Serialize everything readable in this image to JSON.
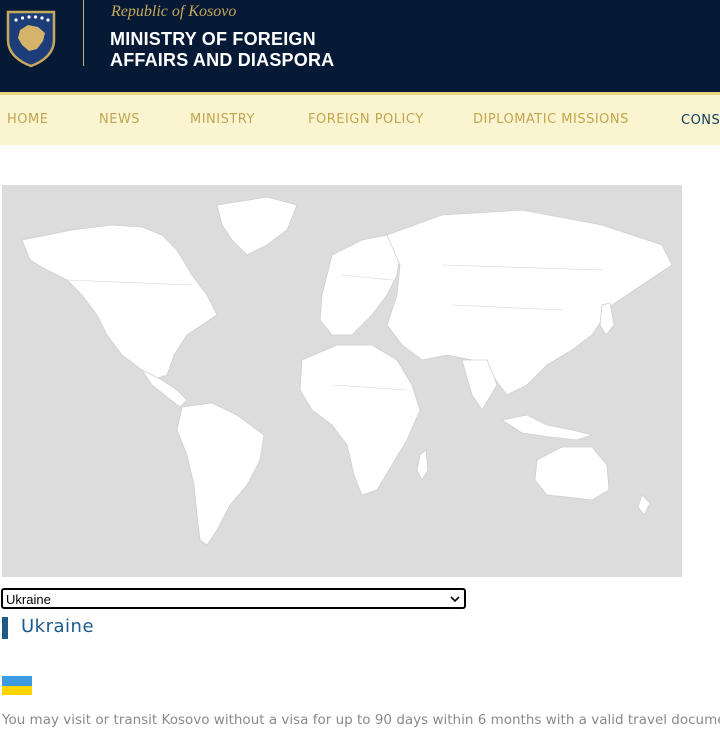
{
  "header": {
    "republic": "Republic of Kosovo",
    "ministry_line1": "MINISTRY OF FOREIGN",
    "ministry_line2": "AFFAIRS AND DIASPORA"
  },
  "nav": {
    "items": [
      {
        "label": "HOME"
      },
      {
        "label": "NEWS"
      },
      {
        "label": "MINISTRY"
      },
      {
        "label": "FOREIGN POLICY"
      },
      {
        "label": "DIPLOMATIC MISSIONS"
      },
      {
        "label": "CONS"
      }
    ]
  },
  "map": {
    "land_color": "#ffffff",
    "sea_color": "#dcdcdc"
  },
  "selector": {
    "selected": "Ukraine"
  },
  "country": {
    "name": "Ukraine",
    "flag_colors": [
      "#3c9ae0",
      "#ffd500"
    ],
    "info": "You may visit or transit Kosovo without a visa for up to 90 days within 6 months with a valid travel document."
  },
  "colors": {
    "header_bg": "#061a36",
    "nav_bg": "#fbf4d1",
    "nav_text": "#c2a64e",
    "accent": "#1d5a8c"
  }
}
